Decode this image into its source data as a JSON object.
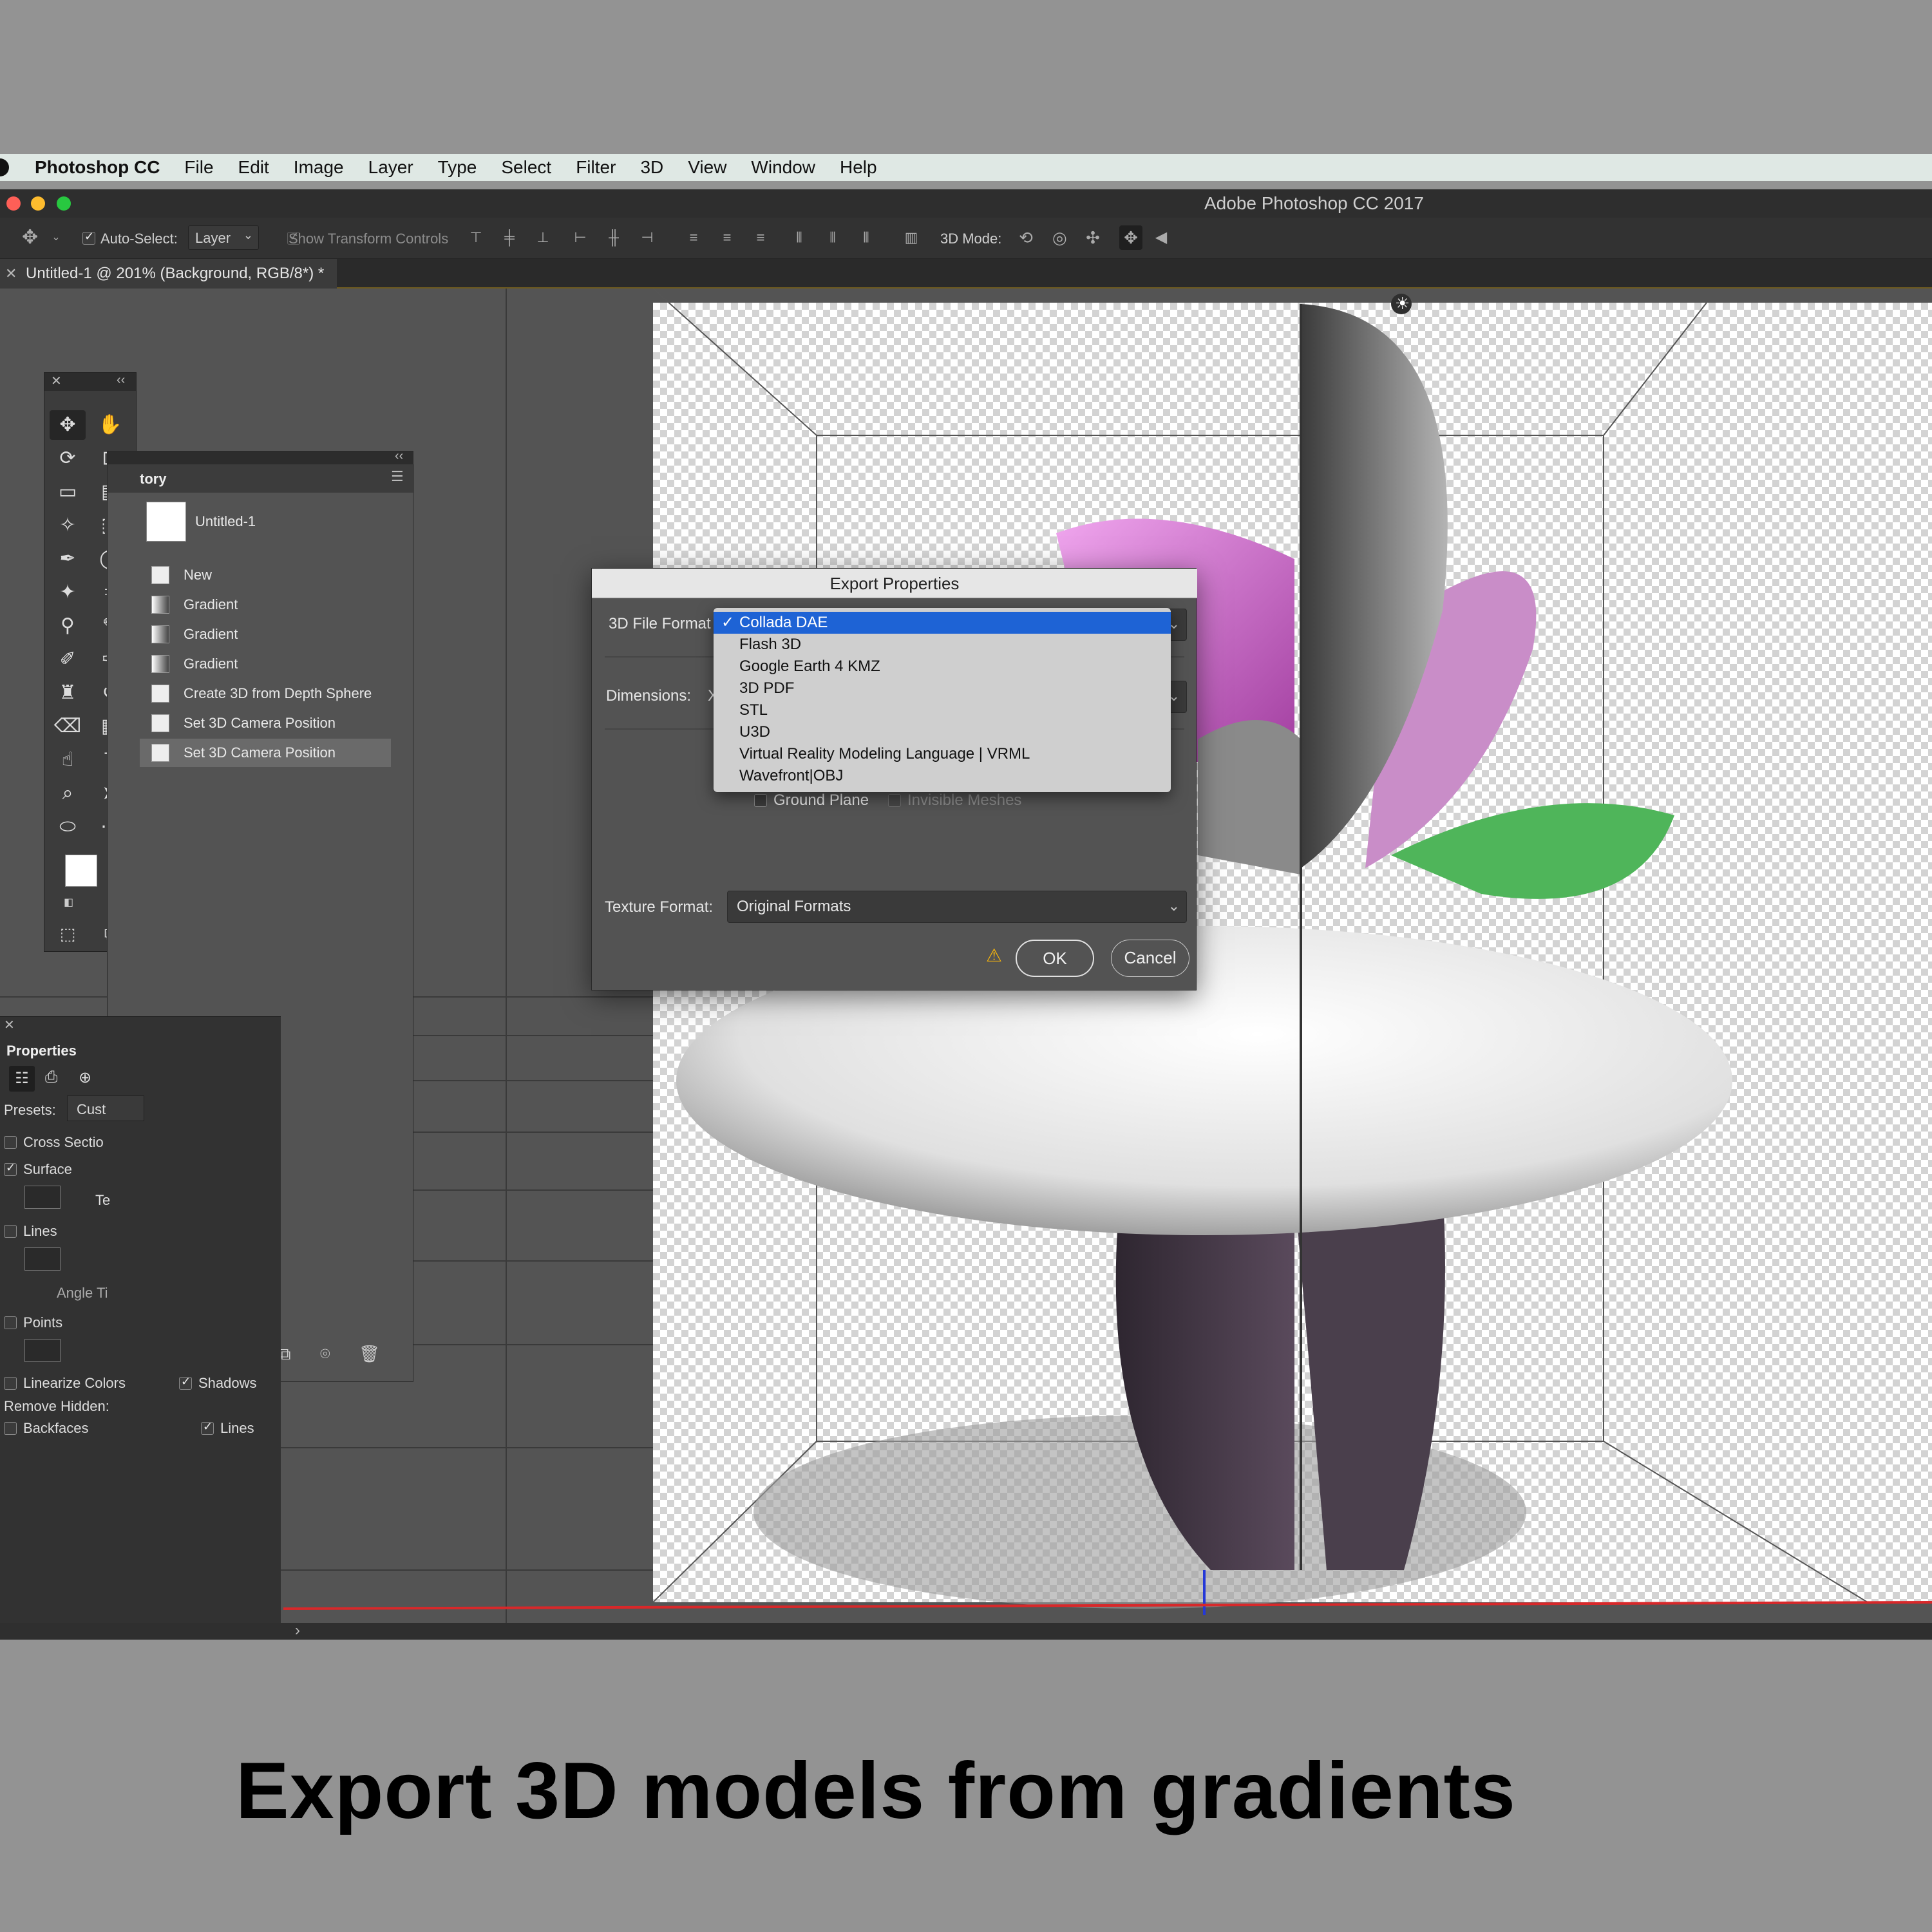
{
  "menubar": {
    "app_name": "Photoshop CC",
    "items": [
      "File",
      "Edit",
      "Image",
      "Layer",
      "Type",
      "Select",
      "Filter",
      "3D",
      "View",
      "Window",
      "Help"
    ]
  },
  "window": {
    "title": "Adobe Photoshop CC 2017"
  },
  "options_bar": {
    "auto_select_label": "Auto-Select:",
    "auto_select_value": "Layer",
    "show_transform_label": "Show Transform Controls",
    "mode_label": "3D Mode:"
  },
  "document": {
    "tab_title": "Untitled-1 @ 201% (Background, RGB/8*) *"
  },
  "history": {
    "title": "tory",
    "snapshot": "Untitled-1",
    "items": [
      "New",
      "Gradient",
      "Gradient",
      "Gradient",
      "Create 3D from Depth Sphere",
      "Set 3D Camera Position",
      "Set 3D Camera Position"
    ]
  },
  "properties": {
    "title": "Properties",
    "presets_label": "Presets:",
    "presets_value": "Cust",
    "cross_section": "Cross Sectio",
    "surface": "Surface",
    "surface_tex": "Te",
    "lines": "Lines",
    "angle": "Angle Ti",
    "points": "Points",
    "linearize": "Linearize Colors",
    "shadows": "Shadows",
    "remove_hidden": "Remove Hidden:",
    "backfaces": "Backfaces",
    "lines2": "Lines"
  },
  "dialog": {
    "title": "Export Properties",
    "format_label": "3D File Format",
    "dimensions_label": "Dimensions:",
    "dimensions_value": "X",
    "ground_plane": "Ground Plane",
    "invisible_meshes": "Invisible Meshes",
    "texture_label": "Texture Format:",
    "texture_value": "Original Formats",
    "ok": "OK",
    "cancel": "Cancel",
    "options": [
      "Collada DAE",
      "Flash 3D",
      "Google Earth 4 KMZ",
      "3D PDF",
      "STL",
      "U3D",
      "Virtual Reality Modeling Language | VRML",
      "Wavefront|OBJ"
    ]
  },
  "colors": {
    "foreground": "#ffffff",
    "background": "#5a1a5e",
    "selection": "#1e63d5"
  },
  "caption": "Export 3D models from gradients"
}
